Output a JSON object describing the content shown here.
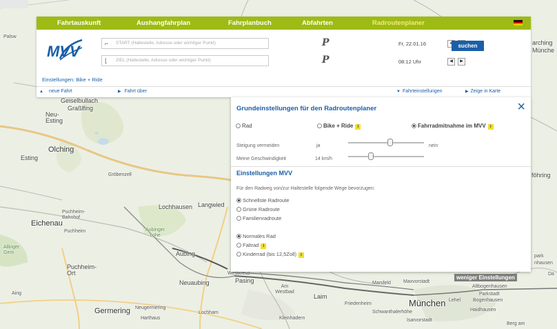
{
  "nav": {
    "items": [
      "Fahrtauskunft",
      "Aushangfahrplan",
      "Fahrplanbuch",
      "Abfahrten",
      "Radroutenplaner"
    ],
    "active_index": 4
  },
  "logo_text": "MVV",
  "search": {
    "start_placeholder": "START (Haltestelle, Adresse oder wichtiger Punkt)",
    "ziel_placeholder": "ZIEL (Haltestelle, Adresse oder wichtiger Punkt)",
    "p_icon": "P",
    "date": "Fr, 22.01.16",
    "time": "08:12 Uhr",
    "button": "suchen"
  },
  "settings_link": "Einstellungen: Bike + Ride",
  "bottom_row": {
    "new_trip": "neue Fahrt",
    "via": "Fahrt über",
    "trip_settings": "Fahrteinstellungen",
    "show_map": "Zeige in Karte"
  },
  "dialog": {
    "title": "Grundeinstellungen für den Radroutenplaner",
    "close_label": "×",
    "modes": [
      {
        "label": "Rad",
        "selected": false,
        "info": false,
        "bold": false
      },
      {
        "label": "Bike + Ride",
        "selected": false,
        "info": true,
        "bold": true
      },
      {
        "label": "Fahrradmitnahme im MVV",
        "selected": true,
        "info": true,
        "bold": true
      }
    ],
    "steigung_label": "Steigung vermeiden",
    "steigung_yes": "ja",
    "steigung_no": "nein",
    "steigung_level": 0.55,
    "speed_label": "Meine Geschwindigkeit",
    "speed_value": "14 km/h",
    "speed_level": 0.3,
    "mvv_title": "Einstellungen MVV",
    "mvv_intro": "Für den Radweg von/zur Haltestelle folgende Wege bevorzugen:",
    "route_options": [
      {
        "label": "Schnellste Radroute",
        "selected": true,
        "info": false
      },
      {
        "label": "Grüne Radroute",
        "selected": false,
        "info": false
      },
      {
        "label": "Familienradroute",
        "selected": false,
        "info": false
      }
    ],
    "bike_options": [
      {
        "label": "Normales Rad",
        "selected": true,
        "info": false
      },
      {
        "label": "Faltrad",
        "selected": false,
        "info": true
      },
      {
        "label": "Kinderrad (bis 12,5Zoll)",
        "selected": false,
        "info": true
      }
    ]
  },
  "less_settings": "weniger Einstellungen",
  "info_icon": "i",
  "map_places": [
    "Geiselbullach",
    "Graßlfing",
    "Neu-Esting",
    "Olching",
    "Esting",
    "Gröbenzell",
    "Eichenau",
    "Puchheim-Bahnhof",
    "Puchheim",
    "Lochhausen",
    "Langwied",
    "Aubinger Lohe",
    "Aubing",
    "Puchheim-Ort",
    "Neuaubing",
    "Germering",
    "Neugermering",
    "Harthaus",
    "Lochham",
    "Pasing",
    "Westkreuz",
    "Am Westbad",
    "Laim",
    "Friedenheim",
    "Marsfeld",
    "Maxvorstadt",
    "München",
    "Lehel",
    "Schwanthalerhöhe",
    "Isarvorstadt",
    "Kleinhadern",
    "Haidhausen",
    "Bogenhausen",
    "Parkstadt",
    "Altbogenhausen",
    "Berg am",
    "arching",
    "Münche",
    "föhring",
    "park",
    "nhausen",
    "Da",
    "Aing",
    "Gröbenzell",
    "Puchheim",
    "Allinger Gern",
    "Palsw"
  ],
  "colors": {
    "nav_green": "#9dbb14",
    "nav_active": "#f5ea76",
    "blue": "#1b5fa7",
    "info_yellow": "#f0dd30"
  }
}
